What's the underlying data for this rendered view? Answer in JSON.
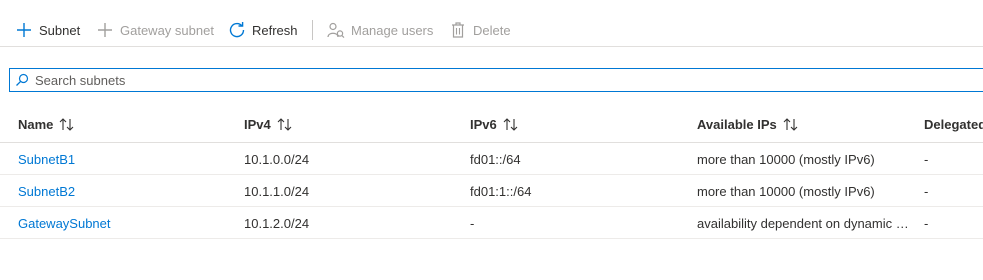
{
  "toolbar": {
    "add_subnet": "Subnet",
    "add_gateway_subnet": "Gateway subnet",
    "refresh": "Refresh",
    "manage_users": "Manage users",
    "delete": "Delete"
  },
  "search": {
    "placeholder": "Search subnets",
    "value": ""
  },
  "table": {
    "columns": [
      "Name",
      "IPv4",
      "IPv6",
      "Available IPs",
      "Delegated to"
    ],
    "rows": [
      {
        "name": "SubnetB1",
        "ipv4": "10.1.0.0/24",
        "ipv6": "fd01::/64",
        "available": "more than 10000 (mostly IPv6)",
        "delegated": "-"
      },
      {
        "name": "SubnetB2",
        "ipv4": "10.1.1.0/24",
        "ipv6": "fd01:1::/64",
        "available": "more than 10000 (mostly IPv6)",
        "delegated": "-"
      },
      {
        "name": "GatewaySubnet",
        "ipv4": "10.1.2.0/24",
        "ipv6": "-",
        "available": "availability dependent on dynamic usage",
        "delegated": "-"
      }
    ]
  },
  "colors": {
    "accent": "#0078d4",
    "disabled": "#a19f9d",
    "text": "#323130"
  }
}
